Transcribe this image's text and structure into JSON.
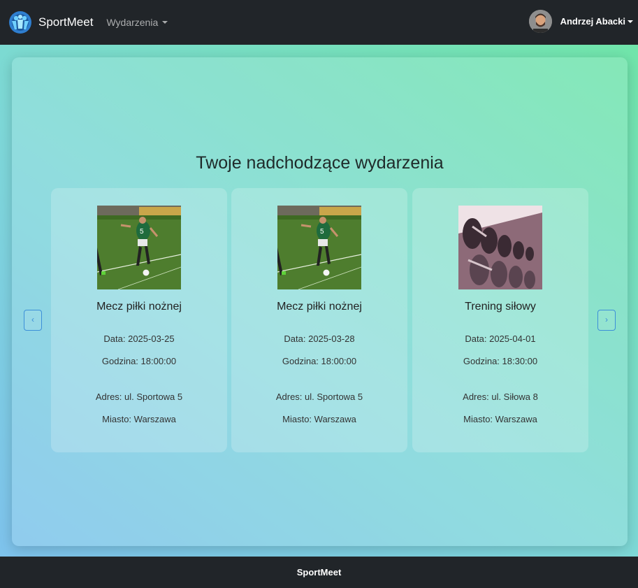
{
  "navbar": {
    "brand": "SportMeet",
    "events_menu": "Wydarzenia",
    "user_name": "Andrzej Abacki"
  },
  "main": {
    "heading": "Twoje nadchodzące wydarzenia",
    "prev_label": "‹",
    "next_label": "›",
    "events": [
      {
        "title": "Mecz piłki nożnej",
        "date": "Data: 2025-03-25",
        "time": "Godzina: 18:00:00",
        "address": "Adres: ul. Sportowa 5",
        "city": "Miasto: Warszawa",
        "image": "football-player-photo"
      },
      {
        "title": "Mecz piłki nożnej",
        "date": "Data: 2025-03-28",
        "time": "Godzina: 18:00:00",
        "address": "Adres: ul. Sportowa 5",
        "city": "Miasto: Warszawa",
        "image": "football-player-photo"
      },
      {
        "title": "Trening siłowy",
        "date": "Data: 2025-04-01",
        "time": "Godzina: 18:30:00",
        "address": "Adres: ul. Siłowa 8",
        "city": "Miasto: Warszawa",
        "image": "dumbbell-rack-photo"
      }
    ]
  },
  "footer": {
    "text": "SportMeet"
  },
  "colors": {
    "navbar_bg": "#212529",
    "accent": "#3c8fd8"
  }
}
